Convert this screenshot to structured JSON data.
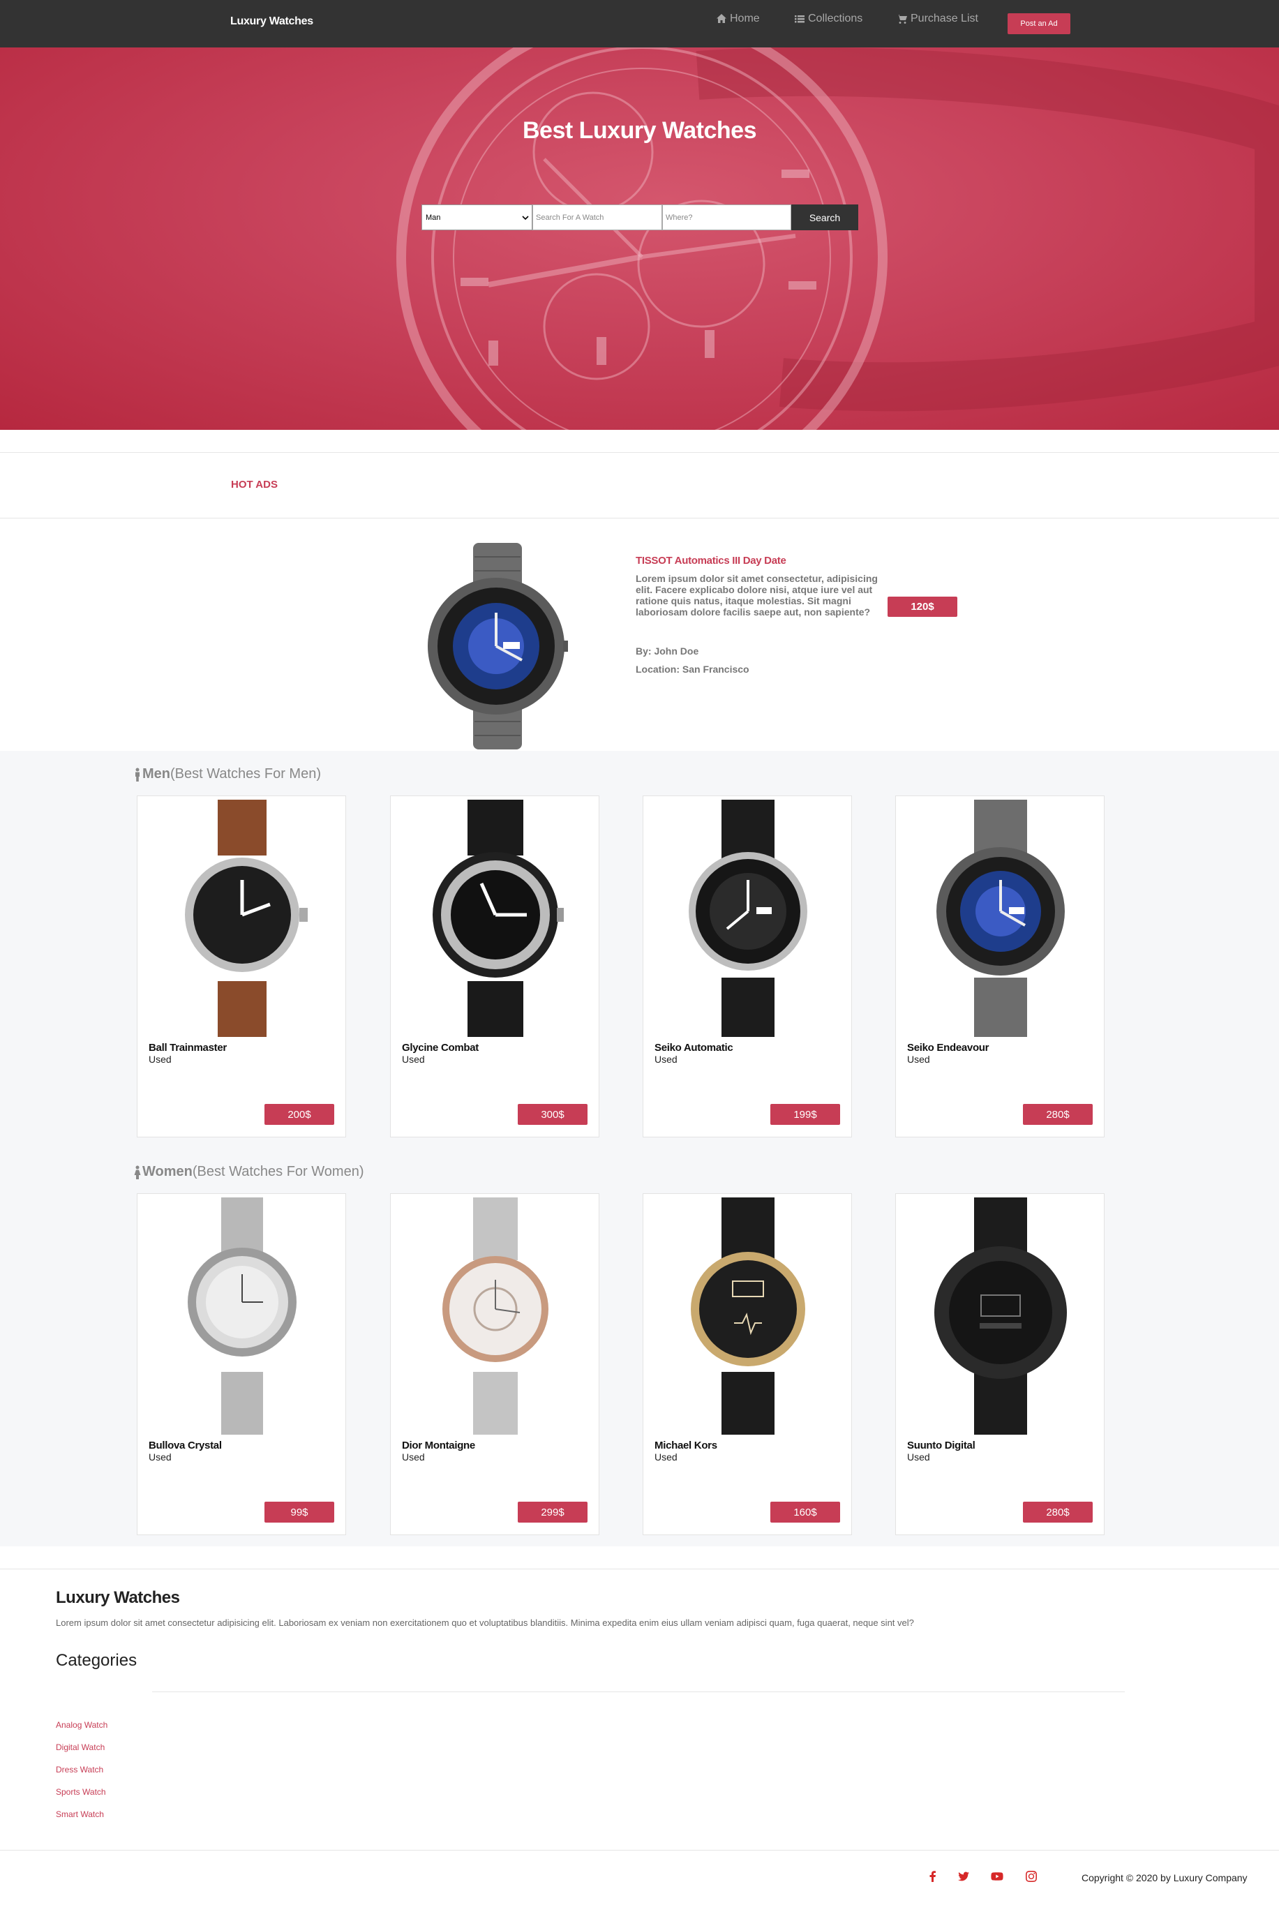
{
  "navbar": {
    "brand": "Luxury Watches",
    "home": "Home",
    "collections": "Collections",
    "purchase_list": "Purchase List",
    "post_ad": "Post an Ad"
  },
  "hero": {
    "title": "Best Luxury Watches",
    "gender_select": "Man",
    "search_placeholder": "Search For A Watch",
    "where_placeholder": "Where?",
    "search_button": "Search"
  },
  "hot_ads": {
    "label": "HOT ADS",
    "title": "TISSOT Automatics III Day Date",
    "description": "Lorem ipsum dolor sit amet consectetur, adipisicing elit. Facere explicabo dolore nisi, atque iure vel aut ratione quis natus, itaque molestias. Sit magni laboriosam dolore facilis saepe aut, non sapiente?",
    "price": "120$",
    "by": "By: John Doe",
    "location": "Location: San Francisco"
  },
  "men": {
    "title": "Men",
    "subtitle": "(Best Watches For Men)",
    "items": [
      {
        "name": "Ball Trainmaster",
        "condition": "Used",
        "price": "200$"
      },
      {
        "name": "Glycine Combat",
        "condition": "Used",
        "price": "300$"
      },
      {
        "name": "Seiko Automatic",
        "condition": "Used",
        "price": "199$"
      },
      {
        "name": "Seiko Endeavour",
        "condition": "Used",
        "price": "280$"
      }
    ]
  },
  "women": {
    "title": "Women",
    "subtitle": "(Best Watches For Women)",
    "items": [
      {
        "name": "Bullova Crystal",
        "condition": "Used",
        "price": "99$"
      },
      {
        "name": "Dior Montaigne",
        "condition": "Used",
        "price": "299$"
      },
      {
        "name": "Michael Kors",
        "condition": "Used",
        "price": "160$"
      },
      {
        "name": "Suunto Digital",
        "condition": "Used",
        "price": "280$"
      }
    ]
  },
  "footer": {
    "title": "Luxury Watches",
    "text": "Lorem ipsum dolor sit amet consectetur adipisicing elit. Laboriosam ex veniam non exercitationem quo et voluptatibus blanditiis. Minima expedita enim eius ullam veniam adipisci quam, fuga quaerat, neque sint vel?",
    "categories_title": "Categories",
    "categories": [
      "Analog Watch",
      "Digital Watch",
      "Dress Watch",
      "Sports Watch",
      "Smart Watch"
    ],
    "copyright": "Copyright © 2020 by Luxury Company"
  },
  "colors": {
    "accent": "#c73d55",
    "navbar": "#333333",
    "hero": "#c8435c"
  },
  "icons": [
    "home-icon",
    "list-icon",
    "cart-icon",
    "male-icon",
    "female-icon",
    "facebook-icon",
    "twitter-icon",
    "youtube-icon",
    "instagram-icon"
  ]
}
